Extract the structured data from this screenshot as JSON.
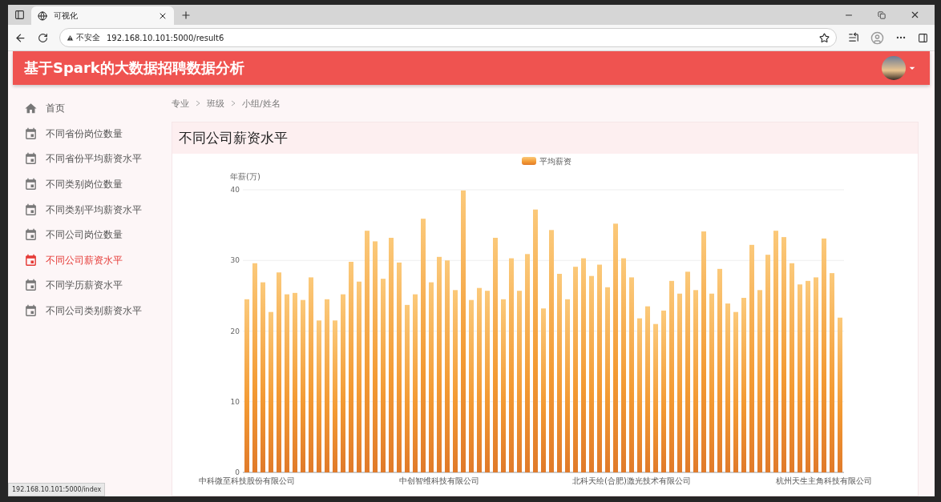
{
  "browser": {
    "tab_title": "可视化",
    "security_label": "不安全",
    "url": "192.168.10.101:5000/result6",
    "status_url": "192.168.10.101:5000/index"
  },
  "header": {
    "title": "基于Spark的大数据招聘数据分析"
  },
  "sidebar": {
    "items": [
      {
        "label": "首页",
        "kind": "home",
        "selected": false
      },
      {
        "label": "不同省份岗位数量",
        "kind": "page",
        "selected": false
      },
      {
        "label": "不同省份平均薪资水平",
        "kind": "page",
        "selected": false
      },
      {
        "label": "不同类别岗位数量",
        "kind": "page",
        "selected": false
      },
      {
        "label": "不同类别平均薪资水平",
        "kind": "page",
        "selected": false
      },
      {
        "label": "不同公司岗位数量",
        "kind": "page",
        "selected": false
      },
      {
        "label": "不同公司薪资水平",
        "kind": "page",
        "selected": true
      },
      {
        "label": "不同学历薪资水平",
        "kind": "page",
        "selected": false
      },
      {
        "label": "不同公司类别薪资水平",
        "kind": "page",
        "selected": false
      }
    ]
  },
  "breadcrumb": [
    "专业",
    "班级",
    "小组/姓名"
  ],
  "card": {
    "title": "不同公司薪资水平",
    "chart_data": {
      "type": "bar",
      "ylabel": "年薪(万)",
      "ylim": [
        0,
        40
      ],
      "yticks": [
        0,
        10,
        20,
        30,
        40
      ],
      "grid": true,
      "categories": [
        "中科微至科技股份有限公司",
        null,
        null,
        null,
        null,
        null,
        null,
        null,
        null,
        null,
        null,
        null,
        null,
        null,
        null,
        null,
        null,
        null,
        null,
        null,
        null,
        null,
        null,
        null,
        "中创智维科技有限公司",
        null,
        null,
        null,
        null,
        null,
        null,
        null,
        null,
        null,
        null,
        null,
        null,
        null,
        null,
        null,
        null,
        null,
        null,
        null,
        null,
        null,
        null,
        null,
        "北科天绘(合肥)激光技术有限公司",
        null,
        null,
        null,
        null,
        null,
        null,
        null,
        null,
        null,
        null,
        null,
        null,
        null,
        null,
        null,
        null,
        null,
        null,
        null,
        null,
        null,
        null,
        null,
        "杭州天生主角科技有限公司",
        null,
        null
      ],
      "series": [
        {
          "name": "平均薪资",
          "color": "#f39a33",
          "values": [
            24.5,
            29.6,
            26.9,
            22.7,
            28.3,
            25.2,
            25.4,
            24.4,
            27.6,
            21.5,
            24.5,
            21.5,
            25.2,
            29.8,
            27.0,
            34.2,
            32.7,
            27.4,
            33.2,
            29.7,
            23.7,
            25.2,
            35.9,
            26.9,
            30.5,
            30.0,
            25.8,
            39.9,
            24.4,
            26.1,
            25.7,
            33.2,
            24.5,
            30.3,
            25.7,
            30.9,
            37.2,
            23.2,
            34.3,
            28.1,
            24.5,
            29.1,
            30.3,
            27.8,
            29.4,
            26.2,
            35.2,
            30.3,
            27.6,
            21.8,
            23.5,
            21.0,
            22.9,
            27.1,
            25.3,
            28.4,
            25.8,
            34.1,
            25.3,
            28.8,
            23.9,
            22.7,
            24.7,
            32.2,
            25.8,
            30.8,
            34.2,
            33.3,
            29.6,
            26.6,
            27.1,
            27.6,
            33.1,
            28.2,
            21.9
          ]
        }
      ]
    }
  }
}
